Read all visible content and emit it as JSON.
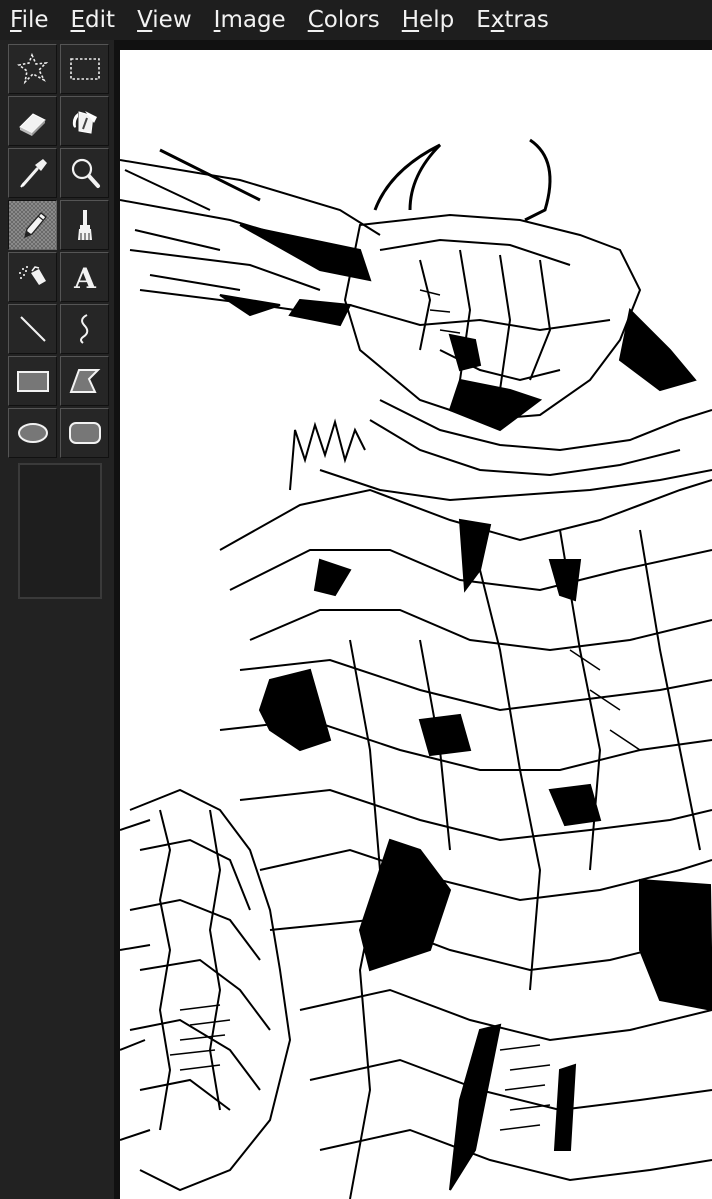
{
  "menu": [
    {
      "prefix": "",
      "mnemonic": "F",
      "rest": "ile"
    },
    {
      "prefix": "",
      "mnemonic": "E",
      "rest": "dit"
    },
    {
      "prefix": "",
      "mnemonic": "V",
      "rest": "iew"
    },
    {
      "prefix": "",
      "mnemonic": "I",
      "rest": "mage"
    },
    {
      "prefix": "",
      "mnemonic": "C",
      "rest": "olors"
    },
    {
      "prefix": "",
      "mnemonic": "H",
      "rest": "elp"
    },
    {
      "prefix": "E",
      "mnemonic": "x",
      "rest": "tras"
    }
  ],
  "tools": [
    {
      "name": "free-form-select-icon",
      "active": false
    },
    {
      "name": "rectangle-select-icon",
      "active": false
    },
    {
      "name": "eraser-icon",
      "active": false
    },
    {
      "name": "fill-bucket-icon",
      "active": false
    },
    {
      "name": "color-picker-icon",
      "active": false
    },
    {
      "name": "magnifier-icon",
      "active": false
    },
    {
      "name": "pencil-icon",
      "active": true
    },
    {
      "name": "brush-icon",
      "active": false
    },
    {
      "name": "airbrush-icon",
      "active": false
    },
    {
      "name": "text-icon",
      "active": false,
      "glyph": "A"
    },
    {
      "name": "line-icon",
      "active": false
    },
    {
      "name": "curve-icon",
      "active": false
    },
    {
      "name": "rectangle-icon",
      "active": false
    },
    {
      "name": "polygon-icon",
      "active": false
    },
    {
      "name": "ellipse-icon",
      "active": false
    },
    {
      "name": "rounded-rectangle-icon",
      "active": false
    }
  ],
  "colors": {
    "background": "#1e1e1e",
    "canvas": "#ffffff",
    "ink": "#000000",
    "menu_text": "#f2f2f2"
  }
}
